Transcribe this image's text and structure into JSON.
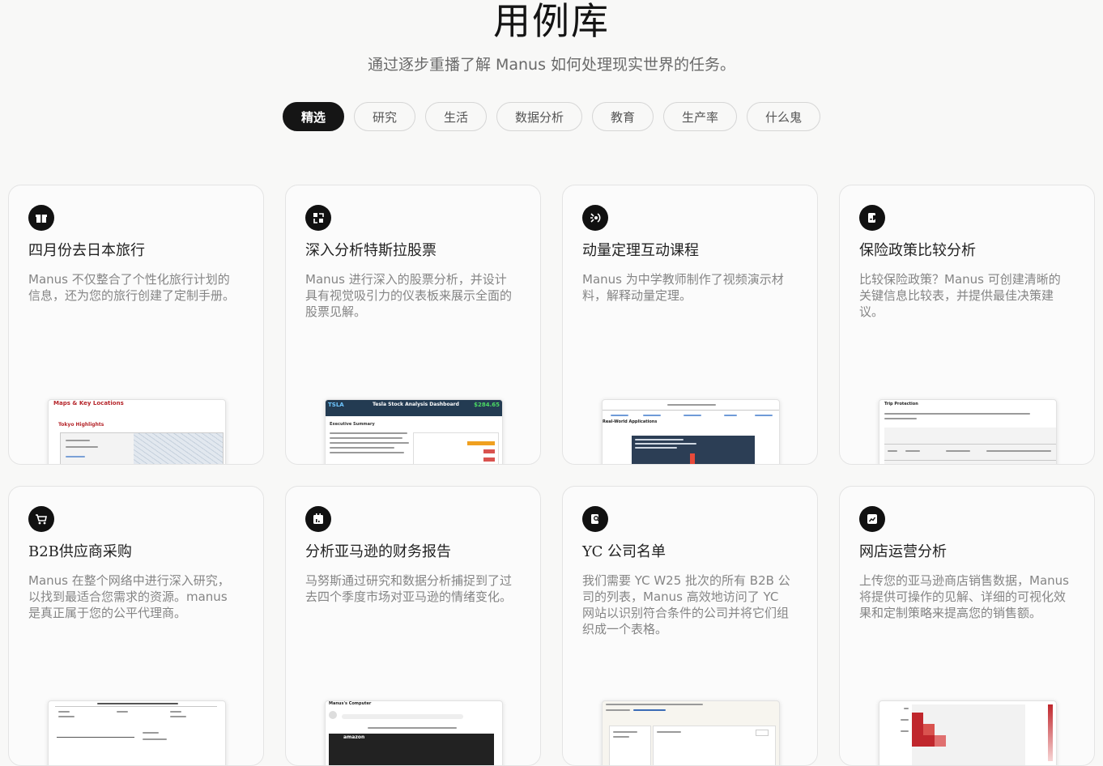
{
  "header": {
    "title": "用例库",
    "subtitle": "通过逐步重播了解 Manus 如何处理现实世界的任务。"
  },
  "tabs": [
    {
      "label": "精选",
      "active": true
    },
    {
      "label": "研究",
      "active": false
    },
    {
      "label": "生活",
      "active": false
    },
    {
      "label": "数据分析",
      "active": false
    },
    {
      "label": "教育",
      "active": false
    },
    {
      "label": "生产率",
      "active": false
    },
    {
      "label": "什么鬼",
      "active": false
    }
  ],
  "cards": [
    {
      "icon": "gift-icon",
      "title": "四月份去日本旅行",
      "description": "Manus 不仅整合了个性化旅行计划的信息，还为您的旅行创建了定制手册。",
      "thumbnail": {
        "title": "Maps & Key Locations",
        "subtitle": "Tokyo Highlights",
        "accent": "#b5252a"
      }
    },
    {
      "icon": "chart-network-icon",
      "title": "深入分析特斯拉股票",
      "description": "Manus 进行深入的股票分析，并设计具有视觉吸引力的仪表板来展示全面的股票见解。",
      "thumbnail": {
        "badge": "TSLA",
        "title": "Tesla Stock Analysis Dashboard",
        "price": "$284.65",
        "section": "Executive Summary",
        "accent": "#233b52"
      }
    },
    {
      "icon": "atom-icon",
      "title": "动量定理互动课程",
      "description": "Manus 为中学教师制作了视频演示材料，解释动量定理。",
      "thumbnail": {
        "section": "Real-World Applications",
        "accent": "#2c3e55"
      }
    },
    {
      "icon": "shield-doc-icon",
      "title": "保险政策比较分析",
      "description": "比较保险政策？Manus 可创建清晰的关键信息比较表，并提供最佳决策建议。",
      "thumbnail": {
        "title": "Trip Protection",
        "accent": "#444444"
      }
    },
    {
      "icon": "cart-icon",
      "title": "B2B供应商采购",
      "description": "Manus 在整个网络中进行深入研究，以找到最适合您需求的资源。manus 是真正属于您的公平代理商。",
      "thumbnail": {
        "accent": "#333333"
      }
    },
    {
      "icon": "calendar-chart-icon",
      "title": "分析亚马逊的财务报告",
      "description": "马努斯通过研究和数据分析捕捉到了过去四个季度市场对亚马逊的情绪变化。",
      "thumbnail": {
        "title": "Manus's Computer",
        "brand": "amazon",
        "accent": "#222222"
      }
    },
    {
      "icon": "document-search-icon",
      "title": "YC 公司名单",
      "description": "我们需要 YC W25 批次的所有 B2B 公司的列表，Manus 高效地访问了 YC 网站以识别符合条件的公司并将它们组织成一个表格。",
      "thumbnail": {
        "accent": "#3b6bb5"
      }
    },
    {
      "icon": "analytics-icon",
      "title": "网店运营分析",
      "description": "上传您的亚马逊商店销售数据，Manus 将提供可操作的见解、详细的可视化效果和定制策略来提高您的销售额。",
      "thumbnail": {
        "accent": "#c0272d"
      }
    }
  ]
}
